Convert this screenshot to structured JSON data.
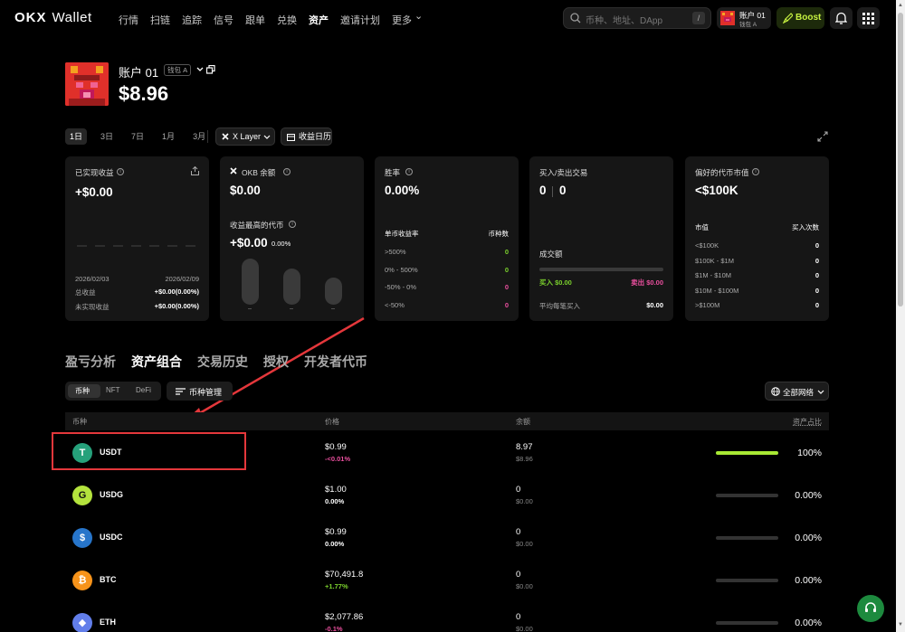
{
  "brand": {
    "mark": "OKX",
    "name": "Wallet"
  },
  "nav": {
    "items": [
      "行情",
      "扫链",
      "追踪",
      "信号",
      "跟单",
      "兑换",
      "资产",
      "邀请计划",
      "更多"
    ],
    "active_index": 6
  },
  "search": {
    "placeholder": "币种、地址、DApp",
    "shortcut": "/"
  },
  "account_pill": {
    "name": "账户 01",
    "wallet": "钱包 A"
  },
  "boost": {
    "label": "Boost"
  },
  "account": {
    "name": "账户 01",
    "wallet_tag": "钱包 A",
    "balance": "$8.96"
  },
  "periods": {
    "items": [
      "1日",
      "3日",
      "7日",
      "1月",
      "3月"
    ],
    "selected_index": 0
  },
  "chain_selector": {
    "label": "X Layer"
  },
  "pnl_calendar": {
    "label": "收益日历"
  },
  "cards": {
    "realized": {
      "title": "已实现收益",
      "value": "+$0.00",
      "date_start": "2026/02/03",
      "date_end": "2026/02/09",
      "total_label": "总收益",
      "total_value": "+$0.00(0.00%)",
      "unrealized_label": "未实现收益",
      "unrealized_value": "+$0.00(0.00%)"
    },
    "okb": {
      "title": "OKB 余额",
      "value": "$0.00",
      "top_label": "收益最高的代币",
      "top_value": "+$0.00",
      "top_pct": "0.00%",
      "bar_labels": [
        "--",
        "--",
        "--"
      ]
    },
    "winrate": {
      "title": "胜率",
      "value": "0.00%",
      "col1": "单币收益率",
      "col2": "币种数",
      "rows": [
        {
          "label": ">500%",
          "count": "0"
        },
        {
          "label": "0% - 500%",
          "count": "0"
        },
        {
          "label": "-50% - 0%",
          "count": "0"
        },
        {
          "label": "<-50%",
          "count": "0"
        }
      ]
    },
    "trades": {
      "title": "买入/卖出交易",
      "buy_count": "0",
      "sell_count": "0",
      "volume_label": "成交额",
      "buy_label": "买入 $0.00",
      "sell_label": "卖出 $0.00",
      "avg_label": "平均每笔买入",
      "avg_value": "$0.00"
    },
    "mcap": {
      "title": "偏好的代币市值",
      "value": "<$100K",
      "col1": "市值",
      "col2": "买入次数",
      "rows": [
        {
          "label": "<$100K",
          "count": "0"
        },
        {
          "label": "$100K - $1M",
          "count": "0"
        },
        {
          "label": "$1M - $10M",
          "count": "0"
        },
        {
          "label": "$10M - $100M",
          "count": "0"
        },
        {
          "label": ">$100M",
          "count": "0"
        }
      ]
    }
  },
  "tabs": {
    "items": [
      "盈亏分析",
      "资产组合",
      "交易历史",
      "授权",
      "开发者代币"
    ],
    "active_index": 1
  },
  "subtabs": {
    "items": [
      "币种",
      "NFT",
      "DeFi"
    ],
    "selected_index": 0
  },
  "coin_manage": {
    "label": "币种管理"
  },
  "network": {
    "label": "全部网络"
  },
  "table": {
    "headers": {
      "coin": "币种",
      "price": "价格",
      "balance": "余额",
      "share": "资产占比"
    },
    "rows": [
      {
        "symbol": "USDT",
        "price": "$0.99",
        "change": "-<0.01%",
        "change_dir": "down",
        "amount": "8.97",
        "value": "$8.96",
        "share": "100%",
        "share_frac": 1.0,
        "icon": "usdt-icon",
        "color": "#26a17b"
      },
      {
        "symbol": "USDG",
        "price": "$1.00",
        "change": "0.00%",
        "change_dir": "flat",
        "amount": "0",
        "value": "$0.00",
        "share": "0.00%",
        "share_frac": 0.0,
        "icon": "usdg-icon",
        "color": "#b4e33d"
      },
      {
        "symbol": "USDC",
        "price": "$0.99",
        "change": "0.00%",
        "change_dir": "flat",
        "amount": "0",
        "value": "$0.00",
        "share": "0.00%",
        "share_frac": 0.0,
        "icon": "usdc-icon",
        "color": "#2775ca"
      },
      {
        "symbol": "BTC",
        "price": "$70,491.8",
        "change": "+1.77%",
        "change_dir": "up",
        "amount": "0",
        "value": "$0.00",
        "share": "0.00%",
        "share_frac": 0.0,
        "icon": "btc-icon",
        "color": "#f7931a"
      },
      {
        "symbol": "ETH",
        "price": "$2,077.86",
        "change": "-0.1%",
        "change_dir": "down",
        "amount": "0",
        "value": "$0.00",
        "share": "0.00%",
        "share_frac": 0.0,
        "icon": "eth-icon",
        "color": "#627eea"
      }
    ]
  }
}
